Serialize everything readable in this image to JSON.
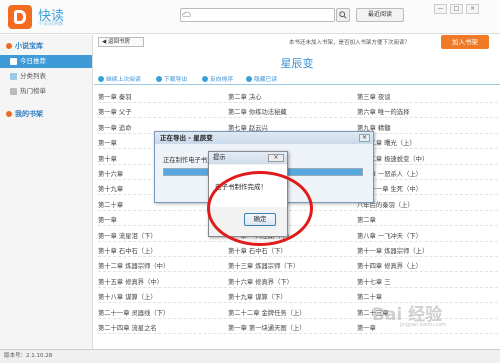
{
  "app": {
    "name": "快读",
    "subtitle": "小说阅读器"
  },
  "header": {
    "recent_label": "最近阅读",
    "win_buttons": [
      "—",
      "□",
      "×"
    ]
  },
  "sidebar": {
    "library_title": "小说宝库",
    "items": [
      {
        "label": "今日推荐"
      },
      {
        "label": "分类列表"
      },
      {
        "label": "热门榜单"
      }
    ],
    "shelf_title": "我的书架"
  },
  "main": {
    "back_label": "返回书房",
    "notice": "本书还未加入书架，是否加入书架方便下次阅读？",
    "add_shelf_label": "加入书架",
    "book_title": "星辰变",
    "tools": [
      "继续上次阅读",
      "下载导出",
      "反向排序",
      "隐藏已读"
    ]
  },
  "chapters": [
    [
      "第一章 秦羽",
      "第二章 决心",
      "第三章 夜谈"
    ],
    [
      "第一章 父子",
      "第二章 你练功法秘藏",
      "第六章 唯一的选择"
    ],
    [
      "第一章 追命",
      "第七章 赵云兴",
      "第九章 精髓"
    ],
    [
      "第一章",
      "",
      "第十二章 曙光（上）"
    ],
    [
      "第十章",
      "",
      "第十二章 极速蜕变（中）"
    ],
    [
      "第十六章",
      "",
      "第十章 一怒杀人（上）"
    ],
    [
      "第十九章",
      "",
      "第二十一章 生死（中）"
    ],
    [
      "第二十章",
      "",
      "八年后的秦羽（上）"
    ],
    [
      "第一章",
      "",
      "第二章"
    ],
    [
      "第一章 流星泪（下）",
      "第一章 一入江湖（下）",
      "第八章 一飞冲天（下）"
    ],
    [
      "第十章 石中石（上）",
      "第十章 石中石（下）",
      "第十一章 炼器宗师（上）"
    ],
    [
      "第十二章 炼器宗师（中）",
      "第十三章 炼器宗师（下）",
      "第十四章 修真界（上）"
    ],
    [
      "第十五章 修真界（中）",
      "第十六章 修真界（下）",
      "第十七章 三"
    ],
    [
      "第十八章 谋算（上）",
      "第十九章 谋算（下）",
      "第二十章"
    ],
    [
      "第二十一章 灵器线（下）",
      "第二十二章 金牌任务（上）",
      "第二十三章"
    ],
    [
      "第二十四章 流星之名",
      "第一章 第一块通天图（上）",
      "第一章"
    ]
  ],
  "export_dialog": {
    "title": "正在导出 - 星辰变",
    "message": "正在制作电子书文件，请稍候...",
    "close": "×",
    "progress": 1.0
  },
  "prompt_dialog": {
    "title": "提示",
    "message": "电子书制作完成！",
    "ok_label": "确定",
    "close": "×"
  },
  "status_bar": {
    "version": "版本号：2.1.10.28"
  },
  "watermark": {
    "text": "Bai 经验",
    "sub": "jingyan.baidu.com"
  }
}
